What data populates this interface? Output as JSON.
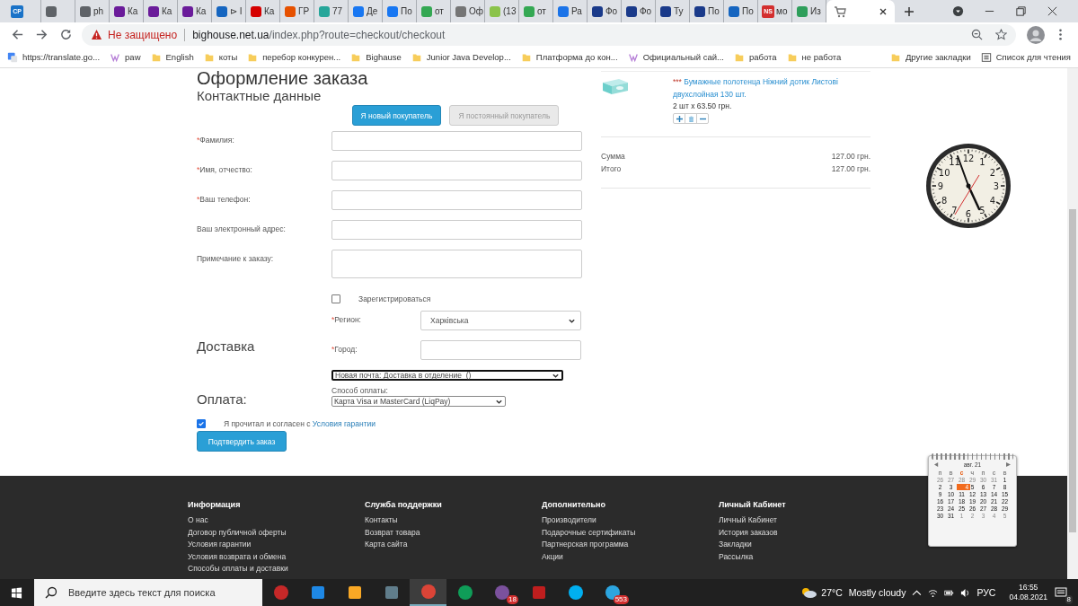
{
  "browser": {
    "tabs": [
      {
        "icon_text": "CP",
        "color": "#1a73c8",
        "selected": false
      },
      {
        "color": "#5f6368",
        "selected": false
      },
      {
        "label": "ph",
        "color": "#5f6368",
        "selected": false
      },
      {
        "label": "Ка",
        "color": "#6a1b9a",
        "selected": false
      },
      {
        "label": "Ка",
        "color": "#6a1b9a",
        "selected": false
      },
      {
        "label": "Ка",
        "color": "#6a1b9a",
        "selected": false
      },
      {
        "label": "⊳ I",
        "color": "#1565c0",
        "selected": false
      },
      {
        "label": "Ка",
        "color": "#d50000",
        "selected": false
      },
      {
        "label": "ГР",
        "color": "#e65100",
        "selected": false
      },
      {
        "label": "77",
        "color": "#26a69a",
        "selected": false
      },
      {
        "label": "Де",
        "color": "#1877f2",
        "selected": false
      },
      {
        "label": "По",
        "color": "#1877f2",
        "selected": false
      },
      {
        "label": "от",
        "color": "#34a853",
        "selected": false
      },
      {
        "label": "Оф",
        "color": "#757575",
        "selected": false
      },
      {
        "label": "(13",
        "color": "#8bc34a",
        "selected": false
      },
      {
        "label": "от",
        "color": "#34a853",
        "selected": false
      },
      {
        "label": "Ра",
        "color": "#1a73e8",
        "selected": false
      },
      {
        "label": "Фо",
        "color": "#1a3a8a",
        "selected": false
      },
      {
        "label": "Фо",
        "color": "#1a3a8a",
        "selected": false
      },
      {
        "label": "Ту",
        "color": "#1a3a8a",
        "selected": false
      },
      {
        "label": "По",
        "color": "#1a3a8a",
        "selected": false
      },
      {
        "label": "По",
        "color": "#1565c0",
        "selected": false
      },
      {
        "icon_text": "NS",
        "label": "мо",
        "color": "#d32f2f",
        "selected": false
      },
      {
        "label": "Из",
        "color": "#2e9e5b",
        "selected": false
      },
      {
        "color": "#757575",
        "selected": true
      }
    ],
    "address": {
      "warning": "Не защищено",
      "host": "bighouse.net.ua",
      "path": "/index.php?route=checkout/checkout"
    },
    "bookmarks": [
      {
        "label": "https://translate.go...",
        "kind": "translate"
      },
      {
        "label": "paw",
        "kind": "site"
      },
      {
        "label": "English",
        "kind": "folder"
      },
      {
        "label": "коты",
        "kind": "folder"
      },
      {
        "label": "перебор конкурен...",
        "kind": "folder"
      },
      {
        "label": "Bighause",
        "kind": "folder"
      },
      {
        "label": "Junior Java Develop...",
        "kind": "folder"
      },
      {
        "label": "Платформа до кон...",
        "kind": "folder"
      },
      {
        "label": "Официальный сай...",
        "kind": "site"
      },
      {
        "label": "работа",
        "kind": "folder"
      },
      {
        "label": "не работа",
        "kind": "folder"
      }
    ],
    "bookmarks_right": [
      {
        "label": "Другие закладки",
        "kind": "folder"
      },
      {
        "label": "Список для чтения",
        "kind": "list"
      }
    ]
  },
  "page": {
    "heading": "Оформление заказа",
    "contact": {
      "title": "Контактные данные",
      "customer_buttons": [
        {
          "label": "Я новый покупатель",
          "selected": true
        },
        {
          "label": "Я постоянный покупатель",
          "selected": false
        }
      ],
      "fields": [
        {
          "label": "Фамилия:",
          "required_mark": "*",
          "kind": "input"
        },
        {
          "label": "Имя, отчество:",
          "required_mark": "*",
          "kind": "input"
        },
        {
          "label": "Ваш телефон:",
          "required_mark": "*",
          "kind": "input"
        },
        {
          "label": "Ваш электронный адрес:",
          "kind": "input"
        },
        {
          "label": "Примечание к заказу:",
          "kind": "textarea"
        }
      ],
      "register": {
        "label": "Зарегистрироваться",
        "checked": false
      }
    },
    "delivery": {
      "title": "Доставка",
      "fields": [
        {
          "label": "Регион:",
          "required_mark": "*",
          "kind": "select",
          "value": "Харківська"
        },
        {
          "label": "Город:",
          "required_mark": "*",
          "kind": "input"
        }
      ],
      "method": "Новая почта: Доставка в отделение  ()"
    },
    "payment": {
      "title": "Оплата:",
      "label": "Способ оплаты:",
      "method": "Карта Visa и MasterCard (LiqPay)"
    },
    "agreement": {
      "checked": true,
      "text": "Я прочитал и согласен с",
      "link": "Условия гарантии"
    },
    "submit": "Подтвердить заказ",
    "cart": {
      "items": [
        {
          "marker": "***",
          "name": "Бумажные полотенца Ніжний дотик Листові двухслойная 130 шт.",
          "quantity": "2 шт x 63.50 грн."
        }
      ],
      "totals": [
        {
          "label": "Сумма",
          "value": "127.00 грн."
        },
        {
          "label": "Итого",
          "value": "127.00 грн."
        }
      ]
    },
    "footer": [
      {
        "title": "Информация",
        "links": [
          "О нас",
          "Договор публичной оферты",
          "Условия гарантии",
          "Условия возврата и обмена",
          "Способы оплаты и доставки"
        ]
      },
      {
        "title": "Служба поддержки",
        "links": [
          "Контакты",
          "Возврат товара",
          "Карта сайта"
        ]
      },
      {
        "title": "Дополнительно",
        "links": [
          "Производители",
          "Подарочные сертификаты",
          "Партнерская программа",
          "Акции"
        ]
      },
      {
        "title": "Личный Кабинет",
        "links": [
          "Личный Кабинет",
          "История заказов",
          "Закладки",
          "Рассылка"
        ]
      }
    ]
  },
  "clock": {
    "numerals": [
      "12",
      "11",
      "1",
      "10",
      "2",
      "9",
      "3",
      "8",
      "4",
      "7",
      "5",
      "6"
    ]
  },
  "calendar": {
    "month": "авг. 21",
    "weekdays": [
      {
        "label": "п",
        "selected": false
      },
      {
        "label": "в",
        "selected": false
      },
      {
        "label": "с",
        "selected": true
      },
      {
        "label": "ч",
        "selected": false
      },
      {
        "label": "п",
        "selected": false
      },
      {
        "label": "с",
        "selected": false
      },
      {
        "label": "в",
        "selected": false
      }
    ],
    "days": [
      {
        "label": "26",
        "muted": true,
        "selected": false
      },
      {
        "label": "27",
        "muted": true,
        "selected": false
      },
      {
        "label": "28",
        "muted": true,
        "selected": false
      },
      {
        "label": "29",
        "muted": true,
        "selected": false
      },
      {
        "label": "30",
        "muted": true,
        "selected": false
      },
      {
        "label": "31",
        "muted": true,
        "selected": false
      },
      {
        "label": "1",
        "muted": false,
        "selected": false
      },
      {
        "label": "2",
        "muted": false,
        "selected": false
      },
      {
        "label": "3",
        "muted": false,
        "selected": false
      },
      {
        "label": "4",
        "muted": false,
        "selected": true
      },
      {
        "label": "5",
        "muted": false,
        "selected": false
      },
      {
        "label": "6",
        "muted": false,
        "selected": false
      },
      {
        "label": "7",
        "muted": false,
        "selected": false
      },
      {
        "label": "8",
        "muted": false,
        "selected": false
      },
      {
        "label": "9",
        "muted": false,
        "selected": false
      },
      {
        "label": "10",
        "muted": false,
        "selected": false
      },
      {
        "label": "11",
        "muted": false,
        "selected": false
      },
      {
        "label": "12",
        "muted": false,
        "selected": false
      },
      {
        "label": "13",
        "muted": false,
        "selected": false
      },
      {
        "label": "14",
        "muted": false,
        "selected": false
      },
      {
        "label": "15",
        "muted": false,
        "selected": false
      },
      {
        "label": "16",
        "muted": false,
        "selected": false
      },
      {
        "label": "17",
        "muted": false,
        "selected": false
      },
      {
        "label": "18",
        "muted": false,
        "selected": false
      },
      {
        "label": "19",
        "muted": false,
        "selected": false
      },
      {
        "label": "20",
        "muted": false,
        "selected": false
      },
      {
        "label": "21",
        "muted": false,
        "selected": false
      },
      {
        "label": "22",
        "muted": false,
        "selected": false
      },
      {
        "label": "23",
        "muted": false,
        "selected": false
      },
      {
        "label": "24",
        "muted": false,
        "selected": false
      },
      {
        "label": "25",
        "muted": false,
        "selected": false
      },
      {
        "label": "26",
        "muted": false,
        "selected": false
      },
      {
        "label": "27",
        "muted": false,
        "selected": false
      },
      {
        "label": "28",
        "muted": false,
        "selected": false
      },
      {
        "label": "29",
        "muted": false,
        "selected": false
      },
      {
        "label": "30",
        "muted": false,
        "selected": false
      },
      {
        "label": "31",
        "muted": false,
        "selected": false
      },
      {
        "label": "1",
        "muted": true,
        "selected": false
      },
      {
        "label": "2",
        "muted": true,
        "selected": false
      },
      {
        "label": "3",
        "muted": true,
        "selected": false
      },
      {
        "label": "4",
        "muted": true,
        "selected": false
      },
      {
        "label": "5",
        "muted": true,
        "selected": false
      }
    ]
  },
  "taskbar": {
    "search_placeholder": "Введите здесь текст для поиска",
    "apps": [
      {
        "kind": "cherry",
        "color": "#c62828",
        "selected": false
      },
      {
        "kind": "network",
        "color": "#1e88e5",
        "selected": false
      },
      {
        "kind": "folder",
        "color": "#f9a825",
        "selected": false
      },
      {
        "kind": "calculator",
        "color": "#607d8b",
        "selected": false
      },
      {
        "kind": "chrome",
        "color": "#db4437",
        "selected": true
      },
      {
        "kind": "edge",
        "color": "#0f9d58",
        "selected": false
      },
      {
        "kind": "viber",
        "color": "#7b519d",
        "selected": false,
        "badge": "18"
      },
      {
        "kind": "filezilla",
        "color": "#bf1e1e",
        "selected": false
      },
      {
        "kind": "skype",
        "color": "#00aff0",
        "selected": false
      },
      {
        "kind": "telegram",
        "color": "#2ca5e0",
        "selected": false,
        "badge": "553"
      }
    ],
    "temperature": "27°C",
    "weather": "Mostly cloudy",
    "language": "РУС",
    "time": "16:55",
    "date": "04.08.2021",
    "notifications": "8"
  }
}
